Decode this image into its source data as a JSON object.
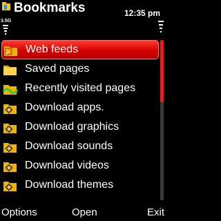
{
  "status": {
    "title": "Bookmarks",
    "time": "12:35 pm",
    "network": "3.5G",
    "app_icon": "bookmark-folder-icon",
    "signal_icon": "signal-strength-icon",
    "battery_icon": "battery-icon"
  },
  "list": {
    "items": [
      {
        "label": "Web feeds",
        "icon": "feed-folder-icon",
        "selected": true
      },
      {
        "label": "Saved pages",
        "icon": "folder-icon"
      },
      {
        "label": "Recently visited pages",
        "icon": "recent-folder-icon"
      },
      {
        "label": "Download apps.",
        "icon": "download-folder-icon"
      },
      {
        "label": "Download graphics",
        "icon": "download-folder-icon"
      },
      {
        "label": "Download sounds",
        "icon": "download-folder-icon"
      },
      {
        "label": "Download videos",
        "icon": "download-folder-icon"
      },
      {
        "label": "Download themes",
        "icon": "download-folder-icon"
      }
    ]
  },
  "softkeys": {
    "left": "Options",
    "middle": "Open",
    "right": "Exit"
  },
  "colors": {
    "selection": "#d20000",
    "scroll_thumb": "#e02020",
    "background": "#000000"
  }
}
